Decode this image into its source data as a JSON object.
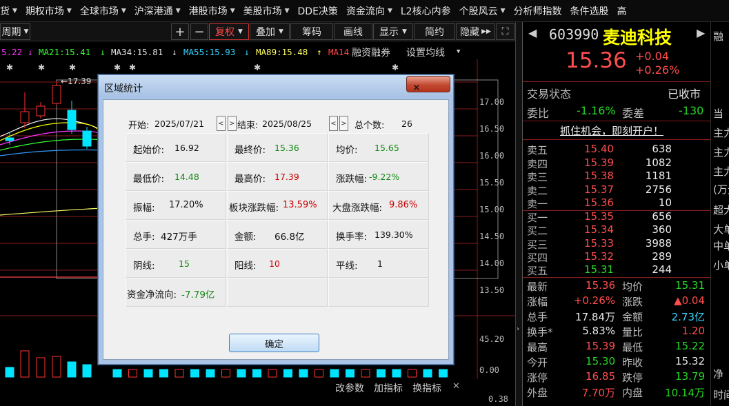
{
  "menu": [
    {
      "label": "货",
      "caret": true
    },
    {
      "label": "期权市场",
      "caret": true
    },
    {
      "label": "全球市场",
      "caret": true
    },
    {
      "label": "沪深港通",
      "caret": true
    },
    {
      "label": "港股市场",
      "caret": true
    },
    {
      "label": "美股市场",
      "caret": true
    },
    {
      "label": "DDE决策",
      "caret": false
    },
    {
      "label": "资金流向",
      "caret": true
    },
    {
      "label": "L2核心内参",
      "caret": false
    },
    {
      "label": "个股风云",
      "caret": true
    },
    {
      "label": "分析师指数",
      "caret": false
    },
    {
      "label": "条件选股",
      "caret": false
    },
    {
      "label": "高",
      "caret": false
    }
  ],
  "toolbar": {
    "period": "周期",
    "plus": "+",
    "minus": "−",
    "fuquan": "复权",
    "diejia": "叠加",
    "chouma": "筹码",
    "huaxian": "画线",
    "xianshi": "显示",
    "jianyue": "简约",
    "yincang": "隐藏"
  },
  "ma_line": {
    "first": "5.22",
    "ma21": "MA21:15.41",
    "ma34": "MA34:15.81",
    "ma55": "MA55:15.93",
    "ma89": "MA89:15.48",
    "ma14": "MA14",
    "rzrq": "融资融券",
    "setting": "设置均线"
  },
  "chart": {
    "high_label": "←17.39",
    "y_ticks": [
      "17.00",
      "16.50",
      "16.00",
      "15.50",
      "15.00",
      "14.50",
      "14.00",
      "13.50"
    ],
    "vol_ticks": [
      "45.20",
      "0.00"
    ],
    "bottom_tick": "0.38",
    "colors": {
      "up": "#ff3333",
      "down": "#00e5ff",
      "ma5": "#ffffff",
      "ma10": "#ffff00",
      "ma21": "#ff33ff",
      "ma34": "#33ff33",
      "ma55": "#3399ff",
      "ma89": "#ffff66"
    }
  },
  "bottom_bar": {
    "gaicanshu": "改参数",
    "jiazhibiao": "加指标",
    "huanzhibiao": "换指标"
  },
  "quote": {
    "code": "603990",
    "name": "麦迪科技",
    "price": "15.36",
    "change": "+0.04",
    "change_pct": "+0.26%",
    "trade_status_label": "交易状态",
    "trade_status": "已收市",
    "weibi_label": "委比",
    "weibi": "-1.16%",
    "weicha_label": "委差",
    "weicha": "-130",
    "promo": "抓住机会，即刻开户！",
    "asks": [
      {
        "label": "卖五",
        "price": "15.40",
        "vol": "638"
      },
      {
        "label": "卖四",
        "price": "15.39",
        "vol": "1082"
      },
      {
        "label": "卖三",
        "price": "15.38",
        "vol": "1181"
      },
      {
        "label": "卖二",
        "price": "15.37",
        "vol": "2756"
      },
      {
        "label": "卖一",
        "price": "15.36",
        "vol": "10"
      }
    ],
    "bids": [
      {
        "label": "买一",
        "price": "15.35",
        "vol": "656"
      },
      {
        "label": "买二",
        "price": "15.34",
        "vol": "360"
      },
      {
        "label": "买三",
        "price": "15.33",
        "vol": "3988"
      },
      {
        "label": "买四",
        "price": "15.32",
        "vol": "289"
      },
      {
        "label": "买五",
        "price": "15.31",
        "vol": "244"
      }
    ],
    "stats": [
      {
        "l1": "最新",
        "v1": "15.36",
        "c1": "red",
        "l2": "均价",
        "v2": "15.31",
        "c2": "green"
      },
      {
        "l1": "涨幅",
        "v1": "+0.26%",
        "c1": "red",
        "l2": "涨跌",
        "v2": "▲0.04",
        "c2": "red"
      },
      {
        "l1": "总手",
        "v1": "17.84万",
        "c1": "white",
        "l2": "金额",
        "v2": "2.73亿",
        "c2": "cyan"
      },
      {
        "l1": "换手*",
        "v1": "5.83%",
        "c1": "white",
        "l2": "量比",
        "v2": "1.20",
        "c2": "red"
      },
      {
        "l1": "最高",
        "v1": "15.39",
        "c1": "red",
        "l2": "最低",
        "v2": "15.22",
        "c2": "green"
      },
      {
        "l1": "今开",
        "v1": "15.30",
        "c1": "green",
        "l2": "昨收",
        "v2": "15.32",
        "c2": "white"
      },
      {
        "l1": "涨停",
        "v1": "16.85",
        "c1": "red",
        "l2": "跌停",
        "v2": "13.79",
        "c2": "green"
      },
      {
        "l1": "外盘",
        "v1": "7.70万",
        "c1": "red",
        "l2": "内盘",
        "v2": "10.14万",
        "c2": "green"
      }
    ],
    "side_items": [
      "融",
      "当",
      "主力",
      "主力",
      "主力",
      "(万元",
      "超大",
      "大单",
      "中单",
      "小单",
      "净",
      "时间"
    ]
  },
  "dialog": {
    "title": "区域统计",
    "close": "✕",
    "start_label": "开始:",
    "start_date": "2025/07/21",
    "end_label": "结束:",
    "end_date": "2025/08/25",
    "count_label": "总个数:",
    "count": "26",
    "cells": [
      {
        "label": "起始价:",
        "value": "16.92",
        "color": "black"
      },
      {
        "label": "最终价:",
        "value": "15.36",
        "color": "green"
      },
      {
        "label": "均价:",
        "value": "15.65",
        "color": "green"
      },
      {
        "label": "最低价:",
        "value": "14.48",
        "color": "green"
      },
      {
        "label": "最高价:",
        "value": "17.39",
        "color": "red"
      },
      {
        "label": "涨跌幅:",
        "value": "-9.22%",
        "color": "green"
      },
      {
        "label": "振幅:",
        "value": "17.20%",
        "color": "black"
      },
      {
        "label": "板块涨跌幅:",
        "value": "13.59%",
        "color": "red"
      },
      {
        "label": "大盘涨跌幅:",
        "value": "9.86%",
        "color": "red"
      },
      {
        "label": "总手:",
        "value": "427万手",
        "color": "black"
      },
      {
        "label": "金额:",
        "value": "66.8亿",
        "color": "black"
      },
      {
        "label": "换手率:",
        "value": "139.30%",
        "color": "black"
      },
      {
        "label": "阴线:",
        "value": "15",
        "color": "green"
      },
      {
        "label": "阳线:",
        "value": "10",
        "color": "red"
      },
      {
        "label": "平线:",
        "value": "1",
        "color": "black"
      }
    ],
    "net_flow_label": "资金净流向:",
    "net_flow": "-7.79亿",
    "ok": "确定"
  }
}
